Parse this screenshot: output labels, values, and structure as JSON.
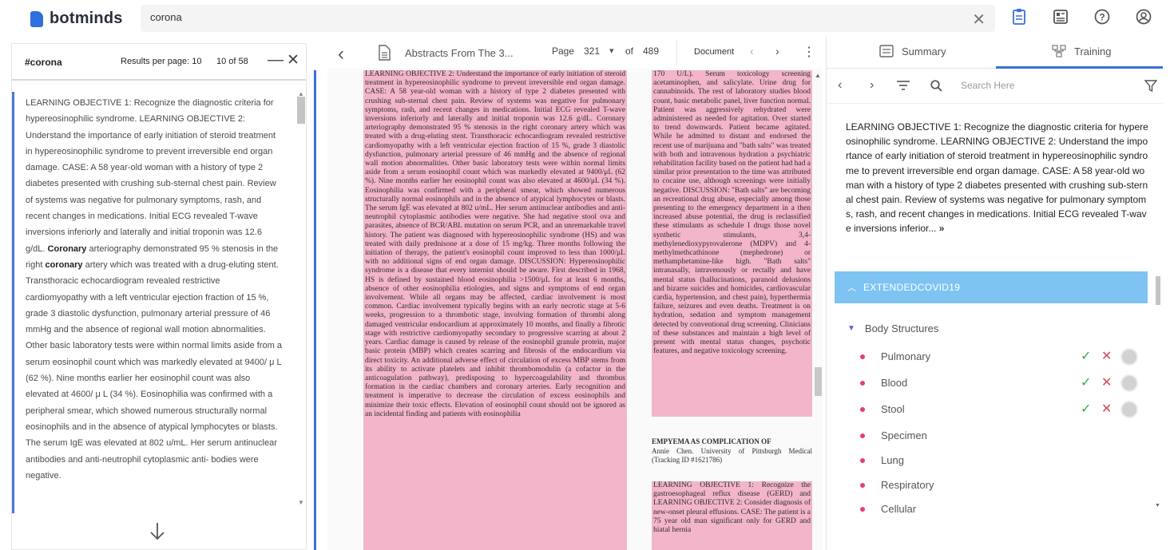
{
  "app": {
    "logo_text": "botminds"
  },
  "search": {
    "value": "corona"
  },
  "left_panel": {
    "tag": "#corona",
    "results_per_page_label": "Results per page: 10",
    "count": "10 of 58",
    "result_text_1": "LEARNING OBJECTIVE 1: Recognize the diagnostic criteria for hypereosinophilic syndrome. LEARNING OBJECTIVE 2: Understand the importance of early initiation of steroid treatment in hypereosinophilic syndrome to prevent irreversible end organ damage. CASE: A 58 year-old woman with a history of type 2 diabetes presented with crushing sub-sternal chest pain. Review of systems was negative for pulmonary symptoms, rash, and recent changes in medications. Initial ECG revealed T-wave inversions inferiorly and laterally and initial troponin was 12.6 g/dL. ",
    "highlight_1": "Coronary",
    "result_text_2": " arteriography demonstrated 95 % stenosis in the right ",
    "highlight_2": "coronary",
    "result_text_3": " artery which was treated with a drug-eluting stent. Transthoracic echocardiogram revealed restrictive cardiomyopathy with a left ventricular ejection fraction of 15 %, grade 3 diastolic dysfunction, pulmonary arterial pressure of 46 mmHg and the absence of regional wall motion abnormalities. Other basic laboratory tests were within normal limits aside from a serum eosinophil count which was markedly elevated at 9400/ μ L (62 %). Nine months earlier her eosinophil count was also elevated at 4600/ μ L (34 %). Eosinophilia was confirmed with a peripheral smear, which showed numerous structurally normal eosinophils and in the absence of atypical lymphocytes or blasts. The serum IgE was elevated at 802 u/mL. Her serum antinuclear antibodies and anti-neutrophil cytoplasmic anti- bodies were negative."
  },
  "viewer": {
    "doc_title": "Abstracts From The 3...",
    "page_label": "Page",
    "page": "321",
    "of_label": "of",
    "total_pages": "489",
    "document_label": "Document",
    "col1": "LEARNING OBJECTIVE 2: Understand the importance of early initiation of steroid treatment in hypereosinophilic syndrome to prevent irreversible end organ damage. CASE: A 58 year-old woman with a history of type 2 diabetes presented with crushing sub-sternal chest pain. Review of systems was negative for pulmonary symptoms, rash, and recent changes in medications. Initial ECG revealed T-wave inversions inferiorly and laterally and initial troponin was 12.6 g/dL. Coronary arteriography demonstrated 95 % stenosis in the right coronary artery which was treated with a drug-eluting stent. Transthoracic echocardiogram revealed restrictive cardiomyopathy with a left ventricular ejection fraction of 15 %, grade 3 diastolic dysfunction, pulmonary arterial pressure of 46 mmHg and the absence of regional wall motion abnormalities. Other basic laboratory tests were within normal limits aside from a serum eosinophil count which was markedly elevated at 9400/μL (62 %). Nine months earlier her eosinophil count was also elevated at 4600/μL (34 %). Eosinophilia was confirmed with a peripheral smear, which showed numerous structurally normal eosinophils and in the absence of atypical lymphocytes or blasts. The serum IgE was elevated at 802 u/mL. Her serum antinuclear antibodies and anti-neutrophil cytoplasmic antibodies were negative. She had negative stool ova and parasites, absence of BCR/ABL mutation on serum PCR, and an unremarkable travel history. The patient was diagnosed with hypereosinophilic syndrome (HS) and was treated with daily prednisone at a dose of 15 mg/kg. Three months following the initiation of therapy, the patient's eosinophil count improved to less than 1000/μL with no additional signs of end organ damage. DISCUSSION: Hypereosinophilic syndrome is a disease that every internist should be aware. First described in 1968, HS is defined by sustained blood eosinophilia >1500/μL for at least 6 months, absence of other eosinophilia etiologies, and signs and symptoms of end organ involvement. While all organs may be affected, cardiac involvement is most common. Cardiac involvement typically begins with an early necrotic stage at 5-6 weeks, progression to a thrombotic stage, involving formation of thrombi along damaged ventricular endocardium at approximately 10 months, and finally a fibrotic stage with restrictive cardiomyopathy secondary to progressive scarring at about 2 years. Cardiac damage is caused by release of the eosinophil granule protein, major basic protein (MBP) which creates scarring and fibrosis of the endocardium via direct toxicity. An additional adverse effect of circulation of excess MBP stems from its ability to activate platelets and inhibit thrombomodulin (a cofactor in the anticoagulation pathway), predisposing to hypercoagulability and thrombus formation in the cardiac chambers and coronary arteries. Early recognition and treatment is imperative to decrease the circulation of excess eosinophils and minimize their toxic effects. Elevation of eosinophil count should not be ignored as an incidental finding and patients with eosinophilia",
    "col2a": "170 U/L). Serum toxicology screening acetaminophen, and salicylate. Urine drug for cannabinoids. The rest of laboratory studies blood count, basic metabolic panel, liver function normal. Patient was aggressively rehydrated were administered as needed for agitation. Over started to trend downwards. Patient became agitated. While he admitted to distant and endorsed the recent use of marijuana and \"bath salts\" was treated with both and intravenous hydration a psychiatric rehabilitation facility based on the patient had had a similar prior presentation to the time was attributed to cocaine use, although screenings were initially negative. DISCUSSION: \"Bath salts\" are becoming an recreational drug abuse, especially among those presenting to the emergency department in a then increased abuse potential, the drug is reclassified these stimulants as schedule I drugs those novel synthetic stimulants, 3,4-methylenedioxypyrovalerone (MDPV) and 4-methylmethcathinone (mephedrone) or methamphetamine-like high. \"Bath salts\" intranasally, intravenously or rectally and have mental status (hallucinations, paranoid delusions and bizarre suicides and homicides, cardiovascular cardia, hypertension, and chest pain), hyperthermia failure, seizures and even deaths. Treatment is on hydration, sedation and symptom management detected by conventional drug screening. Clinicians of these substances and maintain a high level of present with mental status changes, psychotic features, and negative toxicology screening.",
    "col2b_title": "EMPYEMA AS COMPLICATION OF",
    "col2b_text": "Annie Chen. University of Pittsburgh Medical (Tracking ID #1621786)",
    "col2c": "LEARNING OBJECTIVE 1: Recognize the gastroesophageal reflux disease (GERD) and LEARNING OBJECTIVE 2: Consider diagnosis of new-onset pleural effusions. CASE: The patient is a 75 year old man significant only for GERD and hiatal hernia"
  },
  "right_panel": {
    "tab_summary": "Summary",
    "tab_training": "Training",
    "search_placeholder": "Search Here",
    "summary_text": "LEARNING OBJECTIVE 1: Recognize the diagnostic criteria for hypereosinophilic syndrome. LEARNING OBJECTIVE 2: Understand the importance of early initiation of steroid treatment in hypereosinophilic syndrome to prevent irreversible end organ damage. CASE: A 58 year-old woman with a history of type 2 diabetes presented with crushing sub-sternal chest pain. Review of systems was negative for pulmonary symptoms, rash, and recent changes in medications. Initial ECG revealed T-wave inversions inferior... ",
    "more": "»",
    "category": "EXTENDEDCOVID19",
    "group": "Body Structures",
    "items": [
      {
        "label": "Pulmonary"
      },
      {
        "label": "Blood"
      },
      {
        "label": "Stool"
      },
      {
        "label": "Specimen"
      },
      {
        "label": "Lung"
      },
      {
        "label": "Respiratory"
      },
      {
        "label": "Cellular"
      }
    ]
  },
  "colors": {
    "accent": "#3b6fd8",
    "highlight_pink": "#f2b5c9",
    "category_bar": "#7ec3f2",
    "accept_green": "#3aa457",
    "reject_red": "#d4475c",
    "bullet_pink": "#e0407a"
  },
  "icons": {
    "top": [
      "clipboard-icon",
      "grid-doc-icon",
      "help-icon",
      "user-account-icon"
    ],
    "viewer": [
      "back-arrow-icon",
      "document-icon",
      "kebab-menu-icon"
    ],
    "right_toolbar": [
      "prev-icon",
      "next-icon",
      "sort-lines-icon",
      "search-icon",
      "filter-icon"
    ]
  }
}
